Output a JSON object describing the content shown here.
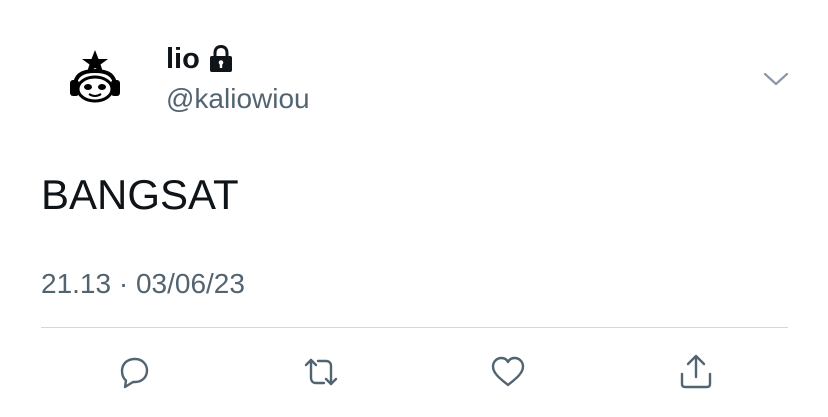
{
  "author": {
    "display_name": "lio",
    "handle": "@kaliowiou",
    "protected": true
  },
  "tweet": {
    "text": "BANGSAT",
    "timestamp": "21.13 · 03/06/23"
  },
  "icons": {
    "avatar": "avatar-icon",
    "lock": "lock-icon",
    "caret": "chevron-down-icon",
    "reply": "reply-icon",
    "retweet": "retweet-icon",
    "like": "heart-icon",
    "share": "share-icon"
  },
  "colors": {
    "primary_text": "#0f1419",
    "secondary_text": "#536471",
    "divider": "#cfd9de"
  }
}
